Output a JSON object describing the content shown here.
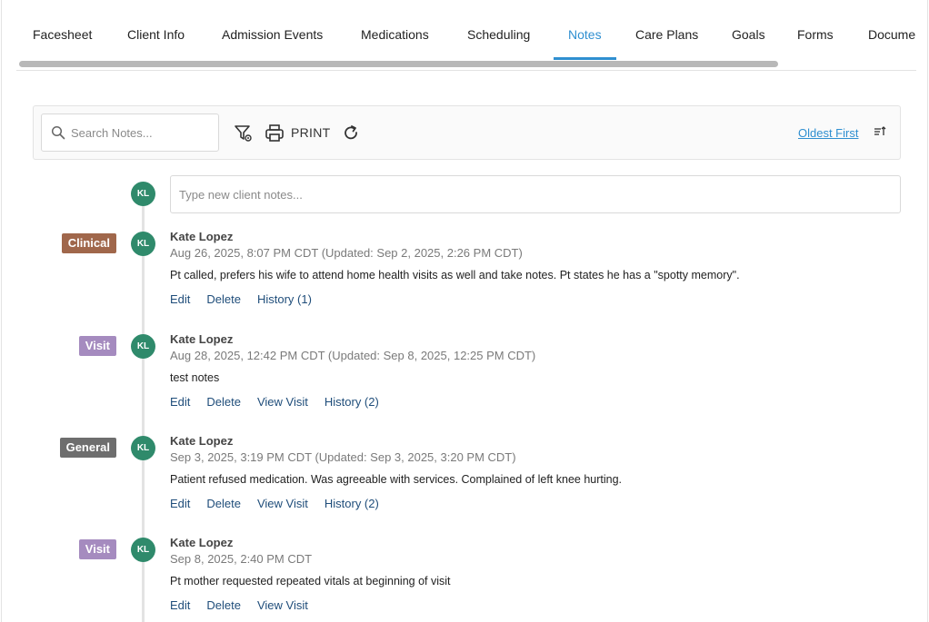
{
  "tabs": [
    {
      "label": "Facesheet",
      "active": false
    },
    {
      "label": "Client Info",
      "active": false
    },
    {
      "label": "Admission Events",
      "active": false
    },
    {
      "label": "Medications",
      "active": false
    },
    {
      "label": "Scheduling",
      "active": false
    },
    {
      "label": "Notes",
      "active": true
    },
    {
      "label": "Care Plans",
      "active": false
    },
    {
      "label": "Goals",
      "active": false
    },
    {
      "label": "Forms",
      "active": false
    },
    {
      "label": "Docume",
      "active": false
    }
  ],
  "toolbar": {
    "search_placeholder": "Search Notes...",
    "search_icon": "search-icon",
    "filter_icon": "filter-settings-icon",
    "print_icon": "printer-icon",
    "print_label": "PRINT",
    "refresh_icon": "refresh-icon",
    "sort_label": "Oldest First",
    "sort_icon": "sort-ascending-icon"
  },
  "new_note": {
    "avatar": "KL",
    "placeholder": "Type new client notes..."
  },
  "notes": [
    {
      "category": "Clinical",
      "category_color": "#a0674b",
      "avatar": "KL",
      "author": "Kate Lopez",
      "timestamp": "Aug 26, 2025, 8:07 PM CDT (Updated: Sep 2, 2025, 2:26 PM CDT)",
      "text": "Pt called, prefers his wife to attend home health visits as well and take notes. Pt states he has a \"spotty memory\".",
      "actions": [
        "Edit",
        "Delete",
        "History (1)"
      ]
    },
    {
      "category": "Visit",
      "category_color": "#a58bbf",
      "avatar": "KL",
      "author": "Kate Lopez",
      "timestamp": "Aug 28, 2025, 12:42 PM CDT (Updated: Sep 8, 2025, 12:25 PM CDT)",
      "text": "test notes",
      "actions": [
        "Edit",
        "Delete",
        "View Visit",
        "History (2)"
      ]
    },
    {
      "category": "General",
      "category_color": "#6e6e6e",
      "avatar": "KL",
      "author": "Kate Lopez",
      "timestamp": "Sep 3, 2025, 3:19 PM CDT (Updated: Sep 3, 2025, 3:20 PM CDT)",
      "text": "Patient refused medication. Was agreeable with services. Complained of left knee hurting.",
      "actions": [
        "Edit",
        "Delete",
        "View Visit",
        "History (2)"
      ]
    },
    {
      "category": "Visit",
      "category_color": "#a58bbf",
      "avatar": "KL",
      "author": "Kate Lopez",
      "timestamp": "Sep 8, 2025, 2:40 PM CDT",
      "text": "Pt mother requested repeated vitals at beginning of visit",
      "actions": [
        "Edit",
        "Delete",
        "View Visit"
      ]
    }
  ]
}
